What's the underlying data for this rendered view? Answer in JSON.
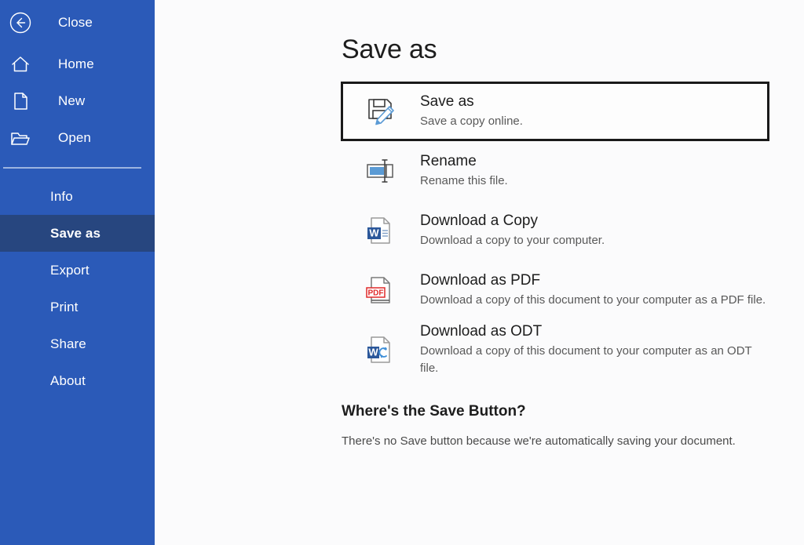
{
  "colors": {
    "sidebar_blue": "#2b5ab8",
    "sidebar_selected": "#27467f",
    "content_bg": "#fbfbfc",
    "focus_border": "#1a1a1a",
    "word_blue": "#2b579a",
    "pdf_red": "#e02a2a",
    "pencil_blue": "#5b9bd5"
  },
  "sidebar": {
    "back": {
      "label": "Close",
      "icon": "back-arrow-circle-icon"
    },
    "top_items": [
      {
        "label": "Home",
        "icon": "home-icon"
      },
      {
        "label": "New",
        "icon": "new-document-icon"
      },
      {
        "label": "Open",
        "icon": "open-folder-icon"
      }
    ],
    "sub_items": [
      {
        "label": "Info",
        "selected": false
      },
      {
        "label": "Save as",
        "selected": true
      },
      {
        "label": "Export",
        "selected": false
      },
      {
        "label": "Print",
        "selected": false
      },
      {
        "label": "Share",
        "selected": false
      },
      {
        "label": "About",
        "selected": false
      }
    ]
  },
  "main": {
    "title": "Save as",
    "options": [
      {
        "title": "Save as",
        "desc": "Save a copy online.",
        "icon": "save-as-floppy-pencil-icon",
        "focused": true
      },
      {
        "title": "Rename",
        "desc": "Rename this file.",
        "icon": "rename-textbox-icon",
        "focused": false
      },
      {
        "title": "Download a Copy",
        "desc": "Download a copy to your computer.",
        "icon": "word-document-icon",
        "focused": false
      },
      {
        "title": "Download as PDF",
        "desc": "Download a copy of this document to your computer as a PDF file.",
        "icon": "pdf-document-icon",
        "focused": false
      },
      {
        "title": "Download as ODT",
        "desc": "Download a copy of this document to your computer as an ODT file.",
        "icon": "odt-convert-document-icon",
        "focused": false
      }
    ],
    "footer": {
      "title": "Where's the Save Button?",
      "desc": "There's no Save button because we're automatically saving your document."
    }
  }
}
